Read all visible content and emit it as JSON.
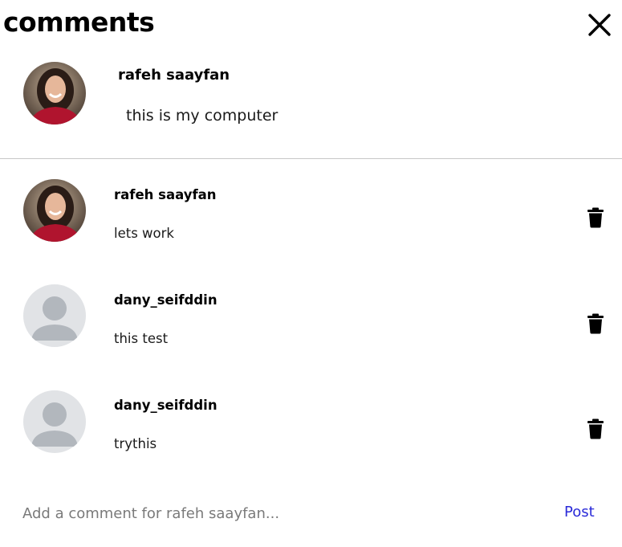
{
  "header": {
    "title": "comments",
    "close_icon": "close-icon"
  },
  "post": {
    "author": "rafeh saayfan",
    "text": "this is my computer",
    "avatar": "photo-avatar"
  },
  "comments": [
    {
      "author": "rafeh saayfan",
      "text": "lets work",
      "avatar": "photo-avatar",
      "delete_icon": "trash-icon"
    },
    {
      "author": "dany_seifddin",
      "text": "this test",
      "avatar": "default-avatar",
      "delete_icon": "trash-icon"
    },
    {
      "author": "dany_seifddin",
      "text": "trythis",
      "avatar": "default-avatar",
      "delete_icon": "trash-icon"
    }
  ],
  "composer": {
    "placeholder": "Add a comment for rafeh saayfan...",
    "value": "",
    "post_label": "Post"
  },
  "colors": {
    "post_link": "#2a2ad8",
    "divider": "#c8c8c8",
    "placeholder": "#7a7a7a",
    "default_avatar_bg": "#e1e3e6",
    "default_avatar_fg": "#b2b7bd"
  }
}
